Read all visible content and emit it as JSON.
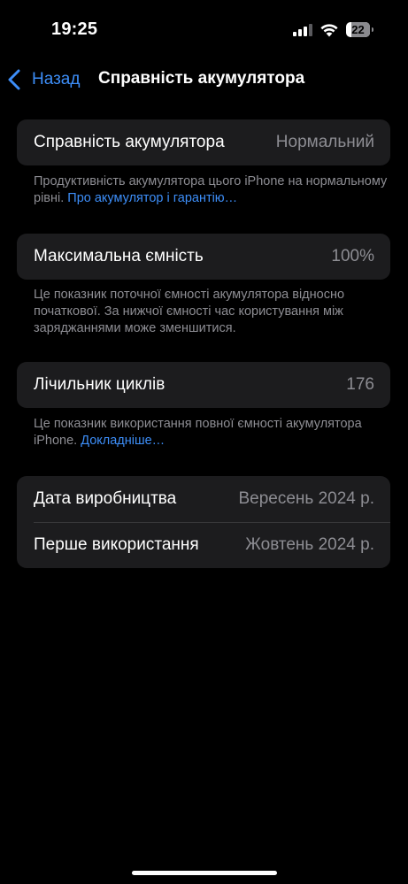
{
  "status_bar": {
    "time": "19:25",
    "battery_level": "22",
    "battery_fraction": 0.22,
    "icons": [
      "cellular-signal-icon",
      "wifi-icon",
      "battery-icon"
    ]
  },
  "nav": {
    "back_label": "Назад",
    "title": "Справність акумулятора",
    "back_icon": "chevron-left-icon"
  },
  "battery_health": {
    "label": "Справність акумулятора",
    "value": "Нормальний",
    "footnote_text": "Продуктивність акумулятора цього iPhone на нормальному рівні.",
    "footnote_link": "Про акумулятор і гарантію…"
  },
  "max_capacity": {
    "label": "Максимальна ємність",
    "value": "100%",
    "footnote_text": "Це показник поточної ємності акумулятора відносно початкової. За нижчої ємності час користування між заряджаннями може зменшитися."
  },
  "cycle_count": {
    "label": "Лічильник циклів",
    "value": "176",
    "footnote_text": "Це показник використання повної ємності акумулятора iPhone.",
    "footnote_link": "Докладніше…"
  },
  "dates": {
    "manufacture_label": "Дата виробництва",
    "manufacture_value": "Вересень 2024 р.",
    "first_use_label": "Перше використання",
    "first_use_value": "Жовтень 2024 р."
  },
  "colors": {
    "background": "#000000",
    "card": "#1c1c1e",
    "accent": "#3d8ef8",
    "secondary_text": "#8d8d93"
  }
}
